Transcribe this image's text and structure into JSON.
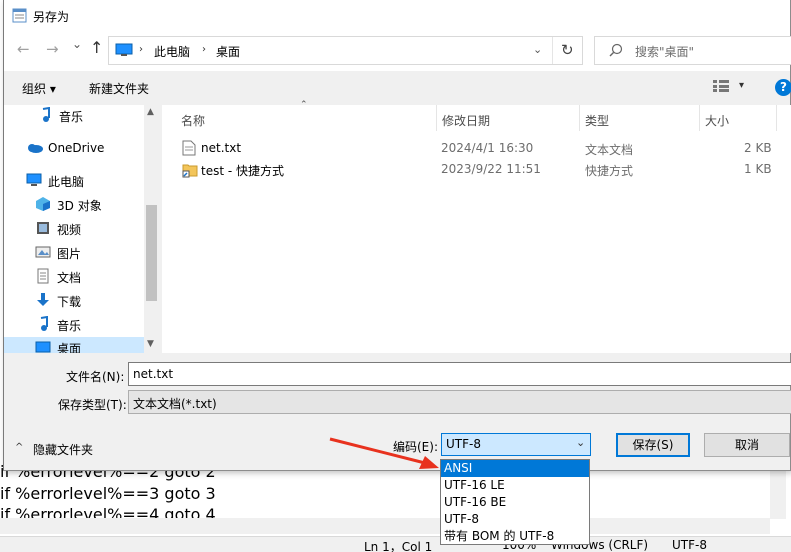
{
  "background": {
    "lines": [
      "if %errorlevel%==2 goto 2",
      "if %errorlevel%==3 goto 3",
      "if %errorlevel%==4 goto 4"
    ],
    "status": {
      "position": "Ln 1，Col 1",
      "zoom": "100%",
      "eol": "Windows (CRLF)",
      "encoding": "UTF-8"
    }
  },
  "dialog": {
    "title": "另存为",
    "nav": {
      "back": "←",
      "forward": "→",
      "recent": "⌄",
      "up": "↑",
      "breadcrumb": [
        "此电脑",
        "桌面"
      ],
      "refresh": "↻",
      "search_placeholder": "搜索\"桌面\""
    },
    "toolbar": {
      "organize": "组织 ▾",
      "new_folder": "新建文件夹",
      "help": "?"
    },
    "navpane": {
      "items": [
        {
          "label": "音乐",
          "icon": "music-note-icon"
        },
        {
          "label": "OneDrive",
          "icon": "cloud-icon"
        },
        {
          "label": "此电脑",
          "icon": "computer-icon"
        },
        {
          "label": "3D 对象",
          "icon": "cube-icon"
        },
        {
          "label": "视频",
          "icon": "video-icon"
        },
        {
          "label": "图片",
          "icon": "picture-icon"
        },
        {
          "label": "文档",
          "icon": "document-icon"
        },
        {
          "label": "下载",
          "icon": "download-icon"
        },
        {
          "label": "音乐",
          "icon": "music-note-icon"
        },
        {
          "label": "桌面",
          "icon": "desktop-icon"
        }
      ]
    },
    "columns": {
      "name": "名称",
      "modified": "修改日期",
      "type": "类型",
      "size": "大小"
    },
    "files": [
      {
        "name": "net.txt",
        "modified": "2024/4/1 16:30",
        "type": "文本文档",
        "size": "2 KB",
        "icon": "text-file-icon"
      },
      {
        "name": "test - 快捷方式",
        "modified": "2023/9/22 11:51",
        "type": "快捷方式",
        "size": "1 KB",
        "icon": "shortcut-icon"
      }
    ],
    "filename_label": "文件名(N):",
    "filename_value": "net.txt",
    "filetype_label": "保存类型(T):",
    "filetype_value": "文本文档(*.txt)",
    "hide_folders": "隐藏文件夹",
    "encoding_label": "编码(E):",
    "encoding_value": "UTF-8",
    "save_button": "保存(S)",
    "cancel_button": "取消",
    "encoding_options": [
      "ANSI",
      "UTF-16 LE",
      "UTF-16 BE",
      "UTF-8",
      "带有 BOM 的 UTF-8"
    ],
    "highlighted_option": "ANSI"
  },
  "colors": {
    "accent": "#0078d7",
    "selection_bg": "#cce8ff",
    "arrow": "#e8321e"
  }
}
